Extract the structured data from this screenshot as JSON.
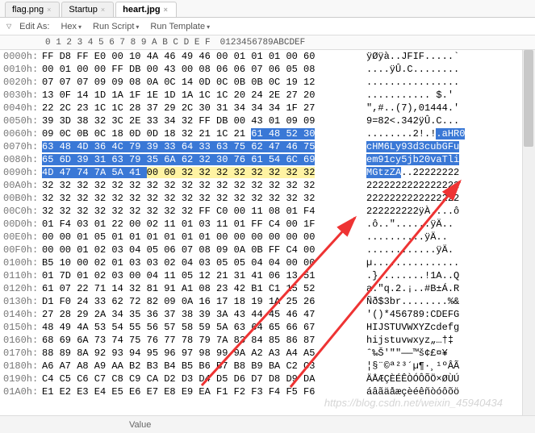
{
  "tabs": [
    {
      "label": "flag.png",
      "active": false
    },
    {
      "label": "Startup",
      "active": false
    },
    {
      "label": "heart.jpg",
      "active": true
    }
  ],
  "toolbar": {
    "editas": "Edit As:",
    "hex": "Hex",
    "runscript": "Run Script",
    "runtemplate": "Run Template"
  },
  "ruler": {
    "hexcols": " 0  1  2  3  4  5  6  7  8  9  A  B  C  D  E  F",
    "asccols": "0123456789ABCDEF"
  },
  "rows": [
    {
      "off": "0000h:",
      "hex": "FF D8 FF E0 00 10 4A 46 49 46 00 01 01 01 00 60",
      "asc": "ÿØÿà..JFIF.....`"
    },
    {
      "off": "0010h:",
      "hex": "00 01 00 00 FF DB 00 43 00 08 06 06 07 06 05 08",
      "asc": "....ÿÛ.C........"
    },
    {
      "off": "0020h:",
      "hex": "07 07 07 09 09 08 0A 0C 14 0D 0C 0B 0B 0C 19 12",
      "asc": "................"
    },
    {
      "off": "0030h:",
      "hex": "13 0F 14 1D 1A 1F 1E 1D 1A 1C 1C 20 24 2E 27 20",
      "asc": "........... $.'"
    },
    {
      "off": "0040h:",
      "hex": "22 2C 23 1C 1C 28 37 29 2C 30 31 34 34 34 1F 27",
      "asc": "\",#..(7),01444.'"
    },
    {
      "off": "0050h:",
      "hex": "39 3D 38 32 3C 2E 33 34 32 FF DB 00 43 01 09 09",
      "asc": "9=82<.342ÿÛ.C..."
    },
    {
      "off": "0060h:",
      "hex": "09 0C 0B 0C 18 0D 0D 18 32 21 1C 21 ",
      "asc": "........2!.!",
      "hextail": "61 48 52 30",
      "asct": ".aHR0",
      "selStart": true
    },
    {
      "off": "0070h:",
      "hex": "63 48 4D 36 4C 79 39 33 64 33 63 75 62 47 46 75",
      "asc": "cHM6Ly93d3cubGFu",
      "allsel": true
    },
    {
      "off": "0080h:",
      "hex": "65 6D 39 31 63 79 35 6A 62 32 30 76 61 54 6C 69",
      "asc": "em91cy5jb20vaTli",
      "allsel": true
    },
    {
      "off": "0090h:",
      "hex": "4D 47 74 7A 5A 41 ",
      "hextail": "00 00 32 32 32 32 32 32 32 32",
      "asc": "MGtzZA",
      "asct": "..22222222",
      "endsel": true
    },
    {
      "off": "00A0h:",
      "hex": "32 32 32 32 32 32 32 32 32 32 32 32 32 32 32 32",
      "asc": "2222222222222222"
    },
    {
      "off": "00B0h:",
      "hex": "32 32 32 32 32 32 32 32 32 32 32 32 32 32 32 32",
      "asc": "2222222222222222"
    },
    {
      "off": "00C0h:",
      "hex": "32 32 32 32 32 32 32 32 32 FF C0 00 11 08 01 F4",
      "asc": "222222222ÿÀ....ô"
    },
    {
      "off": "00D0h:",
      "hex": "01 F4 03 01 22 00 02 11 01 03 11 01 FF C4 00 1F",
      "asc": ".ô..\"......ÿÄ.."
    },
    {
      "off": "00E0h:",
      "hex": "00 00 01 05 01 01 01 01 01 01 00 00 00 00 00 00",
      "asc": "..........ÿÄ.."
    },
    {
      "off": "00F0h:",
      "hex": "00 00 01 02 03 04 05 06 07 08 09 0A 0B FF C4 00",
      "asc": "............ÿÄ."
    },
    {
      "off": "0100h:",
      "hex": "B5 10 00 02 01 03 03 02 04 03 05 05 04 04 00 00",
      "asc": "µ..............."
    },
    {
      "off": "0110h:",
      "hex": "01 7D 01 02 03 00 04 11 05 12 21 31 41 06 13 51",
      "asc": ".}........!1A..Q"
    },
    {
      "off": "0120h:",
      "hex": "61 07 22 71 14 32 81 91 A1 08 23 42 B1 C1 15 52",
      "asc": "a.\"q.2.¡..#B±Á.R"
    },
    {
      "off": "0130h:",
      "hex": "D1 F0 24 33 62 72 82 09 0A 16 17 18 19 1A 25 26",
      "asc": "Ñð$3br........%&"
    },
    {
      "off": "0140h:",
      "hex": "27 28 29 2A 34 35 36 37 38 39 3A 43 44 45 46 47",
      "asc": "'()*456789:CDEFG"
    },
    {
      "off": "0150h:",
      "hex": "48 49 4A 53 54 55 56 57 58 59 5A 63 64 65 66 67",
      "asc": "HIJSTUVWXYZcdefg"
    },
    {
      "off": "0160h:",
      "hex": "68 69 6A 73 74 75 76 77 78 79 7A 83 84 85 86 87",
      "asc": "hijstuvwxyz„…†‡"
    },
    {
      "off": "0170h:",
      "hex": "88 89 8A 92 93 94 95 96 97 98 99 9A A2 A3 A4 A5",
      "asc": "ˆ‰Š'\"\"——™š¢£¤¥"
    },
    {
      "off": "0180h:",
      "hex": "A6 A7 A8 A9 AA B2 B3 B4 B5 B6 B7 B8 B9 BA C2 C3",
      "asc": "¦§¨©ª²³´µ¶·¸¹ºÂÃ"
    },
    {
      "off": "0190h:",
      "hex": "C4 C5 C6 C7 C8 C9 CA D2 D3 D4 D5 D6 D7 D8 D9 DA",
      "asc": "ÄÅÆÇÈÉÊÒÓÔÕÖ×ØÙÚ"
    },
    {
      "off": "01A0h:",
      "hex": "E1 E2 E3 E4 E5 E6 E7 E8 E9 EA F1 F2 F3 F4 F5 F6",
      "asc": "áâãäåæçèéêñòóôõö"
    }
  ],
  "status": {
    "value_label": "Value"
  },
  "watermark": "https://blog.csdn.net/weixin_45940434"
}
